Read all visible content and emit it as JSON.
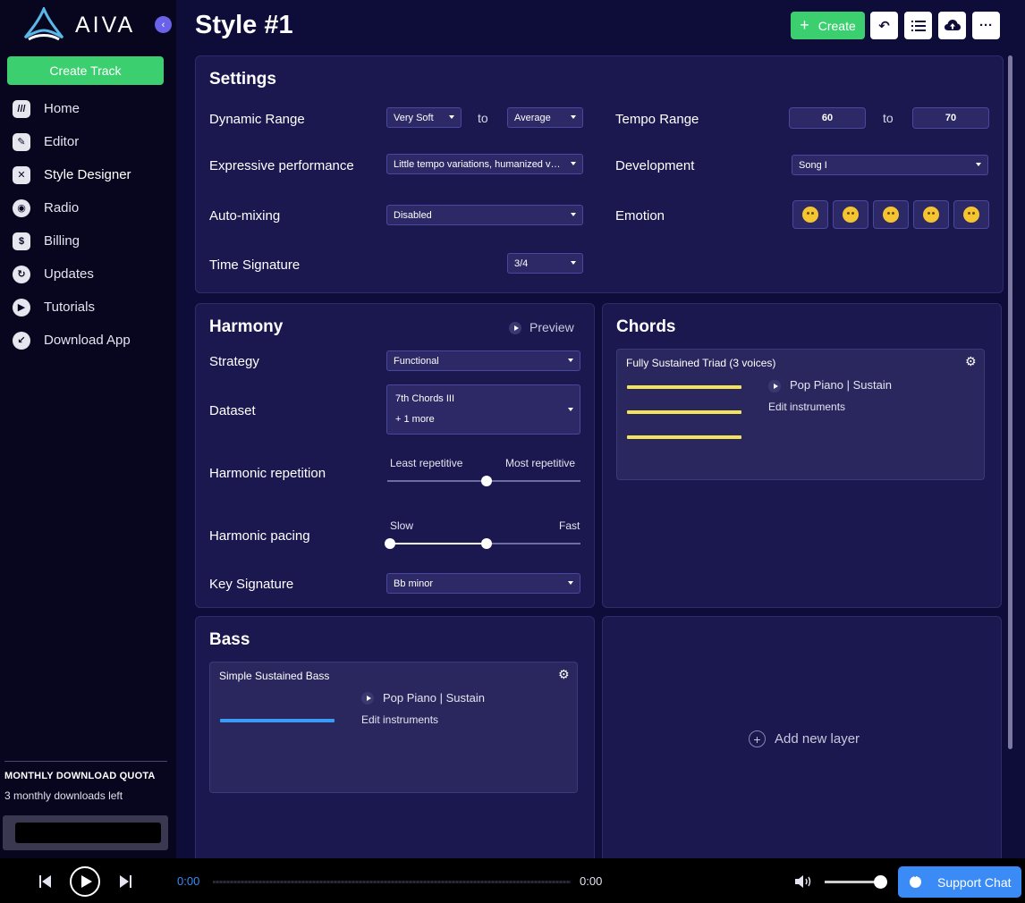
{
  "brand": {
    "name": "AIVA"
  },
  "sidebar": {
    "create_track": "Create Track",
    "items": [
      {
        "label": "Home",
        "icon": "home-icon",
        "glyph": "///"
      },
      {
        "label": "Editor",
        "icon": "pencil-icon",
        "glyph": "✎"
      },
      {
        "label": "Style Designer",
        "icon": "style-designer-icon",
        "glyph": "✕"
      },
      {
        "label": "Radio",
        "icon": "radio-icon",
        "glyph": "◉"
      },
      {
        "label": "Billing",
        "icon": "billing-icon",
        "glyph": "$"
      },
      {
        "label": "Updates",
        "icon": "updates-icon",
        "glyph": "↻"
      },
      {
        "label": "Tutorials",
        "icon": "tutorials-icon",
        "glyph": "▶"
      },
      {
        "label": "Download App",
        "icon": "download-icon",
        "glyph": "↙"
      }
    ],
    "quota_title": "MONTHLY DOWNLOAD QUOTA",
    "quota_text": "3 monthly downloads left"
  },
  "header": {
    "title": "Style #1",
    "create_label": "Create"
  },
  "settings": {
    "title": "Settings",
    "dynamic_range": {
      "label": "Dynamic Range",
      "from": "Very Soft",
      "to_text": "to",
      "to": "Average"
    },
    "tempo_range": {
      "label": "Tempo Range",
      "from": "60",
      "to_text": "to",
      "to": "70"
    },
    "expressive": {
      "label": "Expressive performance",
      "value": "Little tempo variations, humanized velocities"
    },
    "development": {
      "label": "Development",
      "value": "Song I"
    },
    "auto_mixing": {
      "label": "Auto-mixing",
      "value": "Disabled"
    },
    "emotion": {
      "label": "Emotion"
    },
    "time_signature": {
      "label": "Time Signature",
      "value": "3/4"
    }
  },
  "harmony": {
    "title": "Harmony",
    "preview": "Preview",
    "strategy": {
      "label": "Strategy",
      "value": "Functional"
    },
    "dataset": {
      "label": "Dataset",
      "value": "7th Chords III",
      "more": "+ 1 more"
    },
    "repetition": {
      "label": "Harmonic repetition",
      "min": "Least repetitive",
      "max": "Most repetitive",
      "value": 0.5
    },
    "pacing": {
      "label": "Harmonic pacing",
      "min": "Slow",
      "max": "Fast",
      "low": 0.0,
      "high": 0.5
    },
    "key": {
      "label": "Key Signature",
      "value": "Bb minor"
    }
  },
  "chords": {
    "title": "Chords",
    "layer_title": "Fully Sustained Triad (3 voices)",
    "instrument": "Pop Piano | Sustain",
    "edit": "Edit instruments",
    "bar_color": "#f2e35a"
  },
  "bass": {
    "title": "Bass",
    "layer_title": "Simple Sustained Bass",
    "instrument": "Pop Piano | Sustain",
    "edit": "Edit instruments",
    "bar_color": "#3a9bf5"
  },
  "add_layer": "Add new layer",
  "player": {
    "current": "0:00",
    "total": "0:00",
    "support": "Support Chat"
  },
  "colors": {
    "accent_green": "#3ccf70",
    "background": "#0e0c38",
    "card": "#1b1850",
    "support_blue": "#3a8bf5"
  }
}
